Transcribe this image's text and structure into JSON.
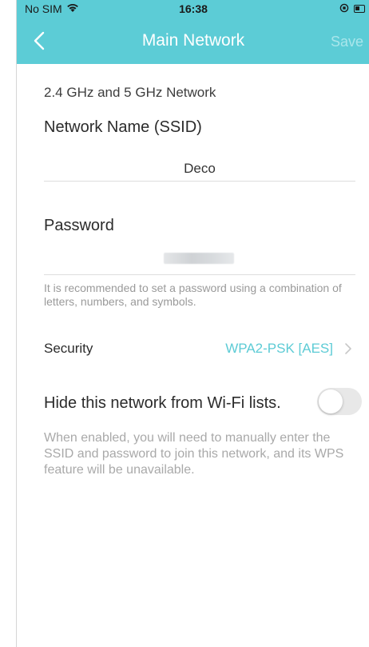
{
  "statusbar": {
    "carrier": "No SIM",
    "time": "16:38",
    "wifi_icon": "wifi-icon",
    "battery_icon": "battery-icon"
  },
  "navbar": {
    "back_icon": "chevron-left-icon",
    "title": "Main Network",
    "save_label": "Save"
  },
  "network": {
    "band_label": "2.4 GHz and 5 GHz Network",
    "ssid_label": "Network Name (SSID)",
    "ssid_value": "Deco",
    "password_label": "Password",
    "password_hint": "It is recommended to set a password using a combination of letters, numbers, and symbols."
  },
  "security": {
    "label": "Security",
    "value": "WPA2-PSK [AES]",
    "chevron_icon": "chevron-right-icon"
  },
  "hide_network": {
    "label": "Hide this network from Wi-Fi lists.",
    "enabled": false,
    "hint": "When enabled, you will need to manually enter the SSID and password to join this network, and its WPS feature will be unavailable."
  },
  "colors": {
    "accent": "#5cccd6",
    "link": "#5ccbd5",
    "save_disabled": "#a9e6eb"
  }
}
